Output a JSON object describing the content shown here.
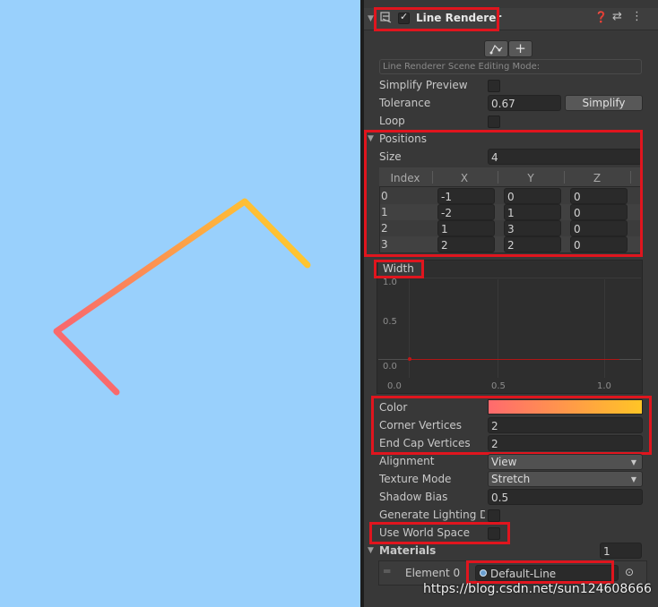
{
  "component": {
    "title": "Line Renderer",
    "enabled": true
  },
  "edit_mode": {
    "placeholder": "Line Renderer Scene Editing Mode:"
  },
  "simplify_preview": {
    "label": "Simplify Preview",
    "checked": false
  },
  "tolerance": {
    "label": "Tolerance",
    "value": "0.67",
    "button": "Simplify"
  },
  "loop": {
    "label": "Loop",
    "checked": false
  },
  "positions": {
    "label": "Positions",
    "size_label": "Size",
    "size_value": "4",
    "headers": [
      "Index",
      "X",
      "Y",
      "Z"
    ],
    "rows": [
      {
        "index": "0",
        "x": "-1",
        "y": "0",
        "z": "0"
      },
      {
        "index": "1",
        "x": "-2",
        "y": "1",
        "z": "0"
      },
      {
        "index": "2",
        "x": "1",
        "y": "3",
        "z": "0"
      },
      {
        "index": "3",
        "x": "2",
        "y": "2",
        "z": "0"
      }
    ]
  },
  "width_curve": {
    "label": "Width",
    "y_ticks": [
      "1.0",
      "0.5",
      "0.0"
    ],
    "x_ticks": [
      "0.0",
      "0.5",
      "1.0"
    ],
    "curve_color": "#b01515"
  },
  "color": {
    "label": "Color",
    "gradient_start": "#ff6a6e",
    "gradient_end": "#ffc526"
  },
  "corner_vertices": {
    "label": "Corner Vertices",
    "value": "2"
  },
  "end_cap_vertices": {
    "label": "End Cap Vertices",
    "value": "2"
  },
  "alignment": {
    "label": "Alignment",
    "value": "View"
  },
  "texture_mode": {
    "label": "Texture Mode",
    "value": "Stretch"
  },
  "shadow_bias": {
    "label": "Shadow Bias",
    "value": "0.5"
  },
  "generate_lighting": {
    "label": "Generate Lighting Da",
    "checked": false
  },
  "use_world_space": {
    "label": "Use World Space",
    "checked": false
  },
  "materials": {
    "label": "Materials",
    "size": "1",
    "element_label": "Element 0",
    "element_value": "Default-Line"
  },
  "watermark": "https://blog.csdn.net/sun124608666",
  "colors": {
    "scene_background": "#99d0fc",
    "highlight": "#e0151e",
    "line_start": "#f96a6c",
    "line_end": "#ffc530"
  }
}
